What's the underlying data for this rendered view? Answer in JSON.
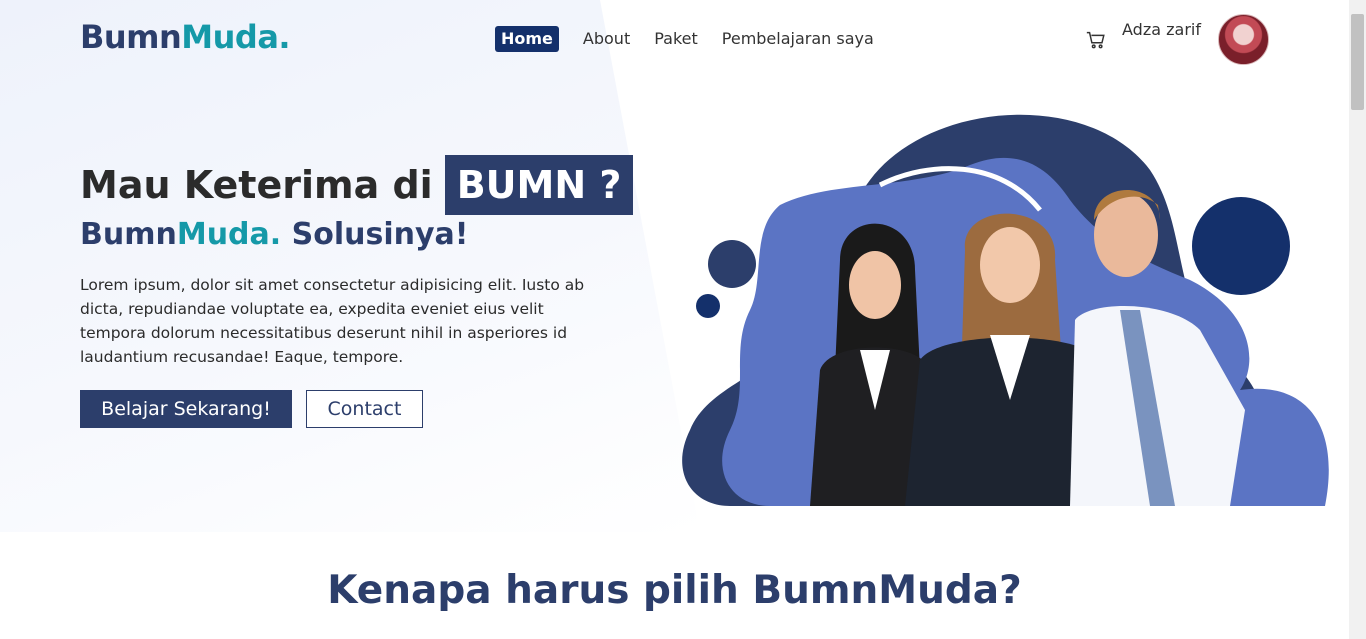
{
  "logo": {
    "main": "Bumn",
    "accent": "Muda."
  },
  "nav": {
    "items": [
      {
        "label": "Home",
        "active": true
      },
      {
        "label": "About",
        "active": false
      },
      {
        "label": "Paket",
        "active": false
      },
      {
        "label": "Pembelajaran saya",
        "active": false
      }
    ]
  },
  "user": {
    "name": "Adza zarif"
  },
  "hero": {
    "title_prefix": "Mau Keterima di",
    "title_box": "BUMN ?",
    "sub_main": "Bumn",
    "sub_accent": "Muda.",
    "sub_rest": " Solusinya!",
    "description": "Lorem ipsum, dolor sit amet consectetur adipisicing elit. Iusto ab dicta, repudiandae voluptate ea, expedita eveniet eius velit tempora dolorum necessitatibus deserunt nihil in asperiores id laudantium recusandae! Eaque, tempore.",
    "primary_button": "Belajar Sekarang!",
    "secondary_button": "Contact"
  },
  "section": {
    "title": "Kenapa harus pilih BumnMuda?",
    "subtitle": ""
  },
  "colors": {
    "brand": "#2c3e6b",
    "accent": "#1599a8",
    "nav_active": "#14306b",
    "blob_light": "#5b74c4"
  }
}
